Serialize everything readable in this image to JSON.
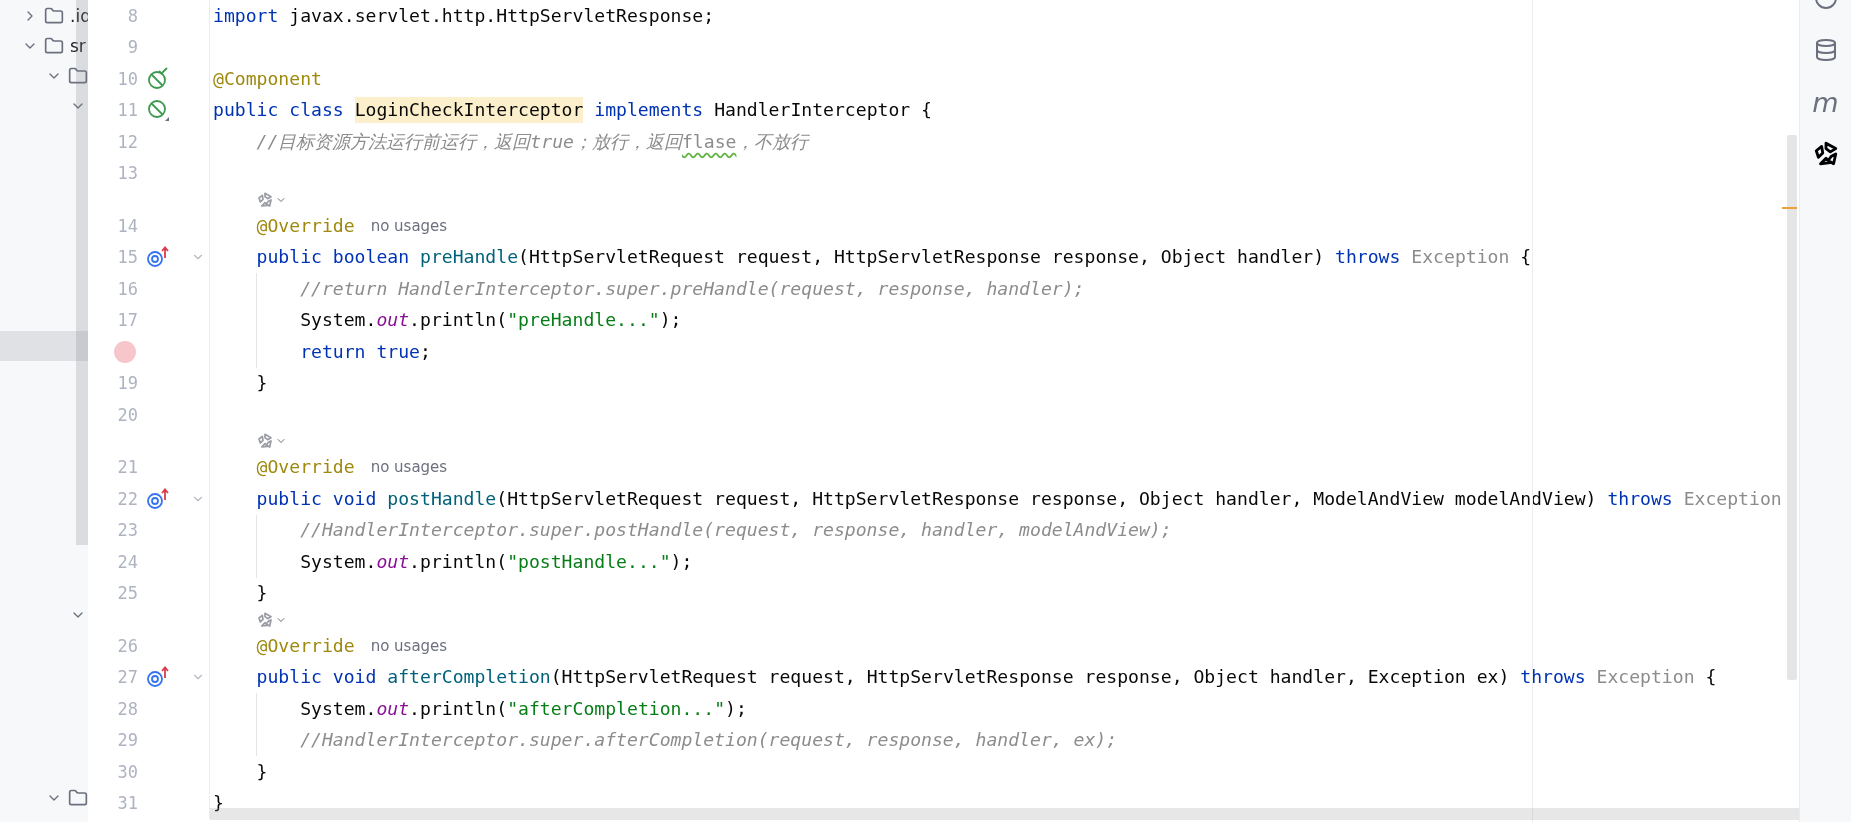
{
  "project_tree": [
    {
      "label": ".id",
      "expanded": false,
      "selected": false
    },
    {
      "label": "sr",
      "expanded": true,
      "selected": false,
      "children": [
        {
          "expanded": true,
          "selected": false,
          "children": [
            {
              "expanded": true,
              "selected": false,
              "children": [
                {
                  "selected": true
                }
              ]
            },
            {
              "expanded": true,
              "selected": false
            }
          ]
        },
        {
          "expanded": true,
          "selected": false
        }
      ]
    }
  ],
  "editor": {
    "lines": [
      {
        "kind": "code",
        "number": "8",
        "breakpoint": false,
        "tokens": [
          {
            "kind": "keyword",
            "text": "import "
          },
          {
            "kind": "plain",
            "text": "javax.servlet.http.HttpServletResponse;"
          }
        ]
      },
      {
        "kind": "code",
        "number": "9",
        "breakpoint": false
      },
      {
        "kind": "code",
        "number": "10",
        "breakpoint": false,
        "marker": {
          "kind": "bean_check"
        },
        "tokens": [
          {
            "kind": "annotation",
            "text": "@Component"
          }
        ]
      },
      {
        "kind": "code",
        "number": "11",
        "breakpoint": false,
        "marker": {
          "kind": "bean"
        },
        "tokens": [
          {
            "kind": "keyword",
            "text": "public class "
          },
          {
            "kind": "highlight",
            "text": "LoginCheckInterceptor"
          },
          {
            "kind": "keyword",
            "text": " implements "
          },
          {
            "kind": "plain",
            "text": "HandlerInterceptor {"
          }
        ]
      },
      {
        "kind": "code",
        "number": "12",
        "breakpoint": false,
        "tokens": [
          {
            "kind": "comment",
            "text": "    //目标资源方法运行前运行，返回true；放行，返回"
          },
          {
            "kind": "typo",
            "text": "flase"
          },
          {
            "kind": "comment",
            "text": "，不放行"
          }
        ]
      },
      {
        "kind": "code",
        "number": "13",
        "breakpoint": false
      },
      {
        "kind": "hint"
      },
      {
        "kind": "code",
        "number": "14",
        "breakpoint": false,
        "tokens": [
          {
            "kind": "annotation",
            "text": "    @Override"
          }
        ],
        "hint": "no usages"
      },
      {
        "kind": "code",
        "number": "15",
        "breakpoint": false,
        "marker": {
          "kind": "implements"
        },
        "fold": true,
        "tokens": [
          {
            "kind": "keyword",
            "text": "    public boolean "
          },
          {
            "kind": "declaration",
            "text": "preHandle"
          },
          {
            "kind": "plain",
            "text": "(HttpServletRequest request, HttpServletResponse response, Object handler) "
          },
          {
            "kind": "keyword",
            "text": "throws "
          },
          {
            "kind": "muted",
            "text": "Exception"
          },
          {
            "kind": "plain",
            "text": " {"
          }
        ]
      },
      {
        "kind": "code",
        "number": "16",
        "breakpoint": false,
        "tokens": [
          {
            "kind": "comment",
            "text": "        //return HandlerInterceptor.super.preHandle(request, response, handler);"
          }
        ]
      },
      {
        "kind": "code",
        "number": "17",
        "breakpoint": false,
        "tokens": [
          {
            "kind": "plain",
            "text": "        System."
          },
          {
            "kind": "static",
            "text": "out"
          },
          {
            "kind": "plain",
            "text": ".println("
          },
          {
            "kind": "string",
            "text": "\"preHandle...\""
          },
          {
            "kind": "plain",
            "text": ");"
          }
        ]
      },
      {
        "kind": "code",
        "breakpoint": true,
        "tokens": [
          {
            "kind": "keyword",
            "text": "        return true"
          },
          {
            "kind": "plain",
            "text": ";"
          }
        ]
      },
      {
        "kind": "code",
        "number": "19",
        "breakpoint": false,
        "tokens": [
          {
            "kind": "plain",
            "text": "    }"
          }
        ]
      },
      {
        "kind": "code",
        "number": "20",
        "breakpoint": false
      },
      {
        "kind": "hint"
      },
      {
        "kind": "code",
        "number": "21",
        "breakpoint": false,
        "tokens": [
          {
            "kind": "annotation",
            "text": "    @Override"
          }
        ],
        "hint": "no usages"
      },
      {
        "kind": "code",
        "number": "22",
        "breakpoint": false,
        "marker": {
          "kind": "implements"
        },
        "fold": true,
        "tokens": [
          {
            "kind": "keyword",
            "text": "    public void "
          },
          {
            "kind": "declaration",
            "text": "postHandle"
          },
          {
            "kind": "plain",
            "text": "(HttpServletRequest request, HttpServletResponse response, Object handler, ModelAndView modelAndView) "
          },
          {
            "kind": "keyword",
            "text": "throws "
          },
          {
            "kind": "muted",
            "text": "Exception"
          }
        ]
      },
      {
        "kind": "code",
        "number": "23",
        "breakpoint": false,
        "tokens": [
          {
            "kind": "comment",
            "text": "        //HandlerInterceptor.super.postHandle(request, response, handler, modelAndView);"
          }
        ]
      },
      {
        "kind": "code",
        "number": "24",
        "breakpoint": false,
        "tokens": [
          {
            "kind": "plain",
            "text": "        System."
          },
          {
            "kind": "static",
            "text": "out"
          },
          {
            "kind": "plain",
            "text": ".println("
          },
          {
            "kind": "string",
            "text": "\"postHandle...\""
          },
          {
            "kind": "plain",
            "text": ");"
          }
        ]
      },
      {
        "kind": "code",
        "number": "25",
        "breakpoint": false,
        "tokens": [
          {
            "kind": "plain",
            "text": "    }"
          }
        ]
      },
      {
        "kind": "hint"
      },
      {
        "kind": "code",
        "number": "26",
        "breakpoint": false,
        "tokens": [
          {
            "kind": "annotation",
            "text": "    @Override"
          }
        ],
        "hint": "no usages"
      },
      {
        "kind": "code",
        "number": "27",
        "breakpoint": false,
        "marker": {
          "kind": "implements"
        },
        "fold": true,
        "tokens": [
          {
            "kind": "keyword",
            "text": "    public void "
          },
          {
            "kind": "declaration",
            "text": "afterCompletion"
          },
          {
            "kind": "plain",
            "text": "(HttpServletRequest request, HttpServletResponse response, Object handler, Exception ex) "
          },
          {
            "kind": "keyword",
            "text": "throws "
          },
          {
            "kind": "muted",
            "text": "Exception"
          },
          {
            "kind": "plain",
            "text": " {"
          }
        ]
      },
      {
        "kind": "code",
        "number": "28",
        "breakpoint": false,
        "tokens": [
          {
            "kind": "plain",
            "text": "        System."
          },
          {
            "kind": "static",
            "text": "out"
          },
          {
            "kind": "plain",
            "text": ".println("
          },
          {
            "kind": "string",
            "text": "\"afterCompletion...\""
          },
          {
            "kind": "plain",
            "text": ");"
          }
        ]
      },
      {
        "kind": "code",
        "number": "29",
        "breakpoint": false,
        "tokens": [
          {
            "kind": "comment",
            "text": "        //HandlerInterceptor.super.afterCompletion(request, response, handler, ex);"
          }
        ]
      },
      {
        "kind": "code",
        "number": "30",
        "breakpoint": false,
        "tokens": [
          {
            "kind": "plain",
            "text": "    }"
          }
        ]
      },
      {
        "kind": "code",
        "number": "31",
        "breakpoint": false,
        "tokens": [
          {
            "kind": "plain",
            "text": "}"
          }
        ]
      }
    ]
  },
  "right_toolbar": [
    {
      "kind": "circle",
      "active": false
    },
    {
      "kind": "database",
      "active": false
    },
    {
      "kind": "letter",
      "label": "m",
      "active": false
    },
    {
      "kind": "ai",
      "active": true
    }
  ]
}
